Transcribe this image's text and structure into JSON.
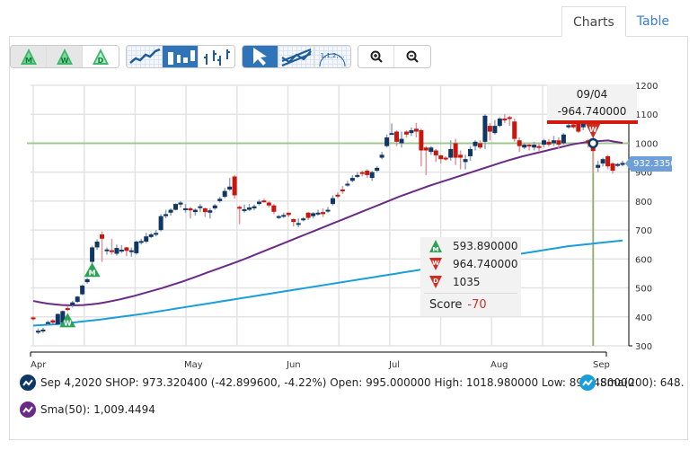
{
  "tabs": [
    {
      "label": "Charts",
      "active": true
    },
    {
      "label": "Table",
      "active": false
    }
  ],
  "toolbar": {
    "period_buttons": [
      {
        "label": "M",
        "icon": "monthly-triangle-icon"
      },
      {
        "label": "W",
        "icon": "weekly-triangle-icon"
      },
      {
        "label": "D",
        "icon": "daily-triangle-icon"
      }
    ],
    "chart_type_buttons": [
      {
        "icon": "line-chart-icon",
        "selected": false
      },
      {
        "icon": "candlestick-chart-icon",
        "selected": true
      },
      {
        "icon": "ohlc-chart-icon",
        "selected": false
      }
    ],
    "tool_buttons": [
      {
        "icon": "pointer-arrow-icon",
        "selected": true
      },
      {
        "icon": "trendline-channel-icon",
        "selected": false
      },
      {
        "icon": "fibonacci-icon",
        "label": "1,1,2,...",
        "selected": false
      }
    ],
    "zoom_buttons": [
      {
        "icon": "zoom-in-icon"
      },
      {
        "icon": "zoom-out-icon"
      }
    ]
  },
  "crosshair": {
    "date": "09/04",
    "value": "-964.740000"
  },
  "last_price_tag": "932.3350",
  "signal_tooltip": {
    "monthly": "593.890000",
    "weekly": "964.740000",
    "daily": "1035",
    "score_label": "Score",
    "score_value": "-70"
  },
  "legend": {
    "main": "Sep 4,2020 SHOP: 973.320400 (-42.899600, -4.22%) Open: 995.000000 High: 1018.980000 Low: 896.480000",
    "sma200": "Sma(200): 648.",
    "sma50": "Sma(50): 1,009.4494"
  },
  "colors": {
    "up": "#0f3766",
    "down": "#c8170c",
    "up_wick": "#8fa3bd",
    "down_wick": "#e0939a",
    "sma50": "#6b2a87",
    "sma200": "#1a9edb",
    "crosshair": "#8fc07a",
    "tab_link": "#3a7bd5"
  },
  "chart_data": {
    "type": "candlestick",
    "symbol": "SHOP",
    "xlabel": "",
    "ylabel": "",
    "ylim": [
      300,
      1200
    ],
    "yticks": [
      300,
      400,
      500,
      600,
      700,
      800,
      900,
      1000,
      1100,
      1200
    ],
    "xticks": [
      "Apr",
      "May",
      "Jun",
      "Jul",
      "Aug",
      "Sep"
    ],
    "grid": true,
    "candles": [
      [
        398,
        392,
        402,
        388
      ],
      [
        350,
        352,
        360,
        340
      ],
      [
        352,
        356,
        362,
        345
      ],
      [
        378,
        382,
        388,
        372
      ],
      [
        388,
        380,
        392,
        376
      ],
      [
        374,
        410,
        412,
        370
      ],
      [
        380,
        420,
        422,
        378
      ],
      [
        430,
        425,
        438,
        420
      ],
      [
        440,
        450,
        455,
        432
      ],
      [
        452,
        470,
        472,
        448
      ],
      [
        478,
        508,
        512,
        475
      ],
      [
        520,
        530,
        535,
        515
      ],
      [
        590,
        640,
        645,
        585
      ],
      [
        640,
        660,
        668,
        632
      ],
      [
        685,
        670,
        695,
        590
      ],
      [
        628,
        633,
        640,
        615
      ],
      [
        630,
        625,
        670,
        615
      ],
      [
        618,
        638,
        650,
        612
      ],
      [
        630,
        632,
        648,
        620
      ],
      [
        640,
        628,
        642,
        610
      ],
      [
        628,
        630,
        640,
        608
      ],
      [
        620,
        660,
        664,
        615
      ],
      [
        658,
        662,
        670,
        650
      ],
      [
        660,
        678,
        690,
        655
      ],
      [
        676,
        685,
        690,
        672
      ],
      [
        686,
        690,
        700,
        678
      ],
      [
        700,
        748,
        755,
        695
      ],
      [
        748,
        755,
        770,
        740
      ],
      [
        760,
        770,
        775,
        750
      ],
      [
        770,
        790,
        792,
        768
      ],
      [
        788,
        795,
        800,
        778
      ],
      [
        770,
        775,
        790,
        760
      ],
      [
        775,
        768,
        780,
        740
      ],
      [
        762,
        770,
        775,
        750
      ],
      [
        778,
        782,
        790,
        762
      ],
      [
        775,
        762,
        778,
        745
      ],
      [
        760,
        768,
        775,
        740
      ],
      [
        775,
        785,
        790,
        770
      ],
      [
        800,
        808,
        815,
        795
      ],
      [
        815,
        835,
        845,
        810
      ],
      [
        840,
        850,
        880,
        835
      ],
      [
        885,
        820,
        890,
        808
      ],
      [
        780,
        775,
        785,
        720
      ],
      [
        768,
        772,
        788,
        760
      ],
      [
        770,
        778,
        790,
        765
      ],
      [
        775,
        782,
        788,
        768
      ],
      [
        790,
        798,
        805,
        785
      ],
      [
        802,
        798,
        808,
        795
      ],
      [
        795,
        785,
        800,
        778
      ],
      [
        785,
        763,
        790,
        755
      ],
      [
        742,
        748,
        752,
        738
      ],
      [
        748,
        752,
        760,
        742
      ],
      [
        760,
        752,
        760,
        745
      ],
      [
        738,
        728,
        740,
        712
      ],
      [
        718,
        724,
        740,
        710
      ],
      [
        738,
        740,
        745,
        730
      ],
      [
        760,
        742,
        762,
        735
      ],
      [
        748,
        758,
        762,
        740
      ],
      [
        755,
        760,
        770,
        750
      ],
      [
        762,
        755,
        775,
        745
      ],
      [
        765,
        770,
        780,
        760
      ],
      [
        790,
        810,
        820,
        785
      ],
      [
        822,
        818,
        830,
        810
      ],
      [
        840,
        838,
        852,
        825
      ],
      [
        855,
        860,
        870,
        850
      ],
      [
        870,
        880,
        890,
        865
      ],
      [
        888,
        890,
        900,
        880
      ],
      [
        900,
        895,
        905,
        885
      ],
      [
        905,
        890,
        910,
        880
      ],
      [
        880,
        900,
        905,
        870
      ],
      [
        905,
        915,
        920,
        900
      ],
      [
        950,
        960,
        970,
        945
      ],
      [
        990,
        1020,
        1030,
        985
      ],
      [
        1030,
        1035,
        1068,
        1030
      ],
      [
        1040,
        1005,
        1045,
        990
      ],
      [
        1000,
        1015,
        1040,
        985
      ],
      [
        1040,
        1030,
        1045,
        1020
      ],
      [
        1035,
        1045,
        1055,
        1025
      ],
      [
        1050,
        1040,
        1070,
        1020
      ],
      [
        1045,
        975,
        1050,
        920
      ],
      [
        985,
        975,
        990,
        890
      ],
      [
        970,
        985,
        990,
        960
      ],
      [
        975,
        958,
        980,
        935
      ],
      [
        958,
        945,
        960,
        930
      ],
      [
        950,
        948,
        955,
        940
      ],
      [
        950,
        980,
        1010,
        940
      ],
      [
        1000,
        950,
        1015,
        925
      ],
      [
        960,
        950,
        975,
        910
      ],
      [
        935,
        945,
        960,
        910
      ],
      [
        955,
        980,
        990,
        940
      ],
      [
        990,
        1005,
        1010,
        975
      ],
      [
        1000,
        985,
        1010,
        980
      ],
      [
        1005,
        1095,
        1100,
        980
      ],
      [
        1060,
        1040,
        1070,
        1010
      ],
      [
        1035,
        1060,
        1080,
        1030
      ],
      [
        1060,
        1085,
        1090,
        1055
      ],
      [
        1085,
        1080,
        1100,
        1070
      ],
      [
        1090,
        1085,
        1095,
        1060
      ],
      [
        1075,
        1015,
        1085,
        1005
      ],
      [
        1010,
        990,
        1020,
        970
      ],
      [
        985,
        995,
        1000,
        980
      ],
      [
        995,
        990,
        1000,
        975
      ],
      [
        985,
        995,
        1005,
        975
      ],
      [
        990,
        985,
        1000,
        970
      ],
      [
        995,
        1010,
        1015,
        985
      ],
      [
        1005,
        995,
        1015,
        988
      ],
      [
        1000,
        1010,
        1025,
        990
      ],
      [
        1010,
        995,
        1020,
        980
      ],
      [
        1000,
        1030,
        1035,
        995
      ],
      [
        1055,
        1062,
        1075,
        1050
      ],
      [
        1065,
        1055,
        1070,
        1050
      ],
      [
        1070,
        1040,
        1075,
        1035
      ],
      [
        1055,
        1070,
        1080,
        1045
      ],
      [
        1010,
        1000,
        1015,
        985
      ],
      [
        995,
        973,
        1019,
        896
      ],
      [
        915,
        925,
        940,
        900
      ],
      [
        930,
        945,
        950,
        920
      ],
      [
        955,
        920,
        960,
        910
      ],
      [
        930,
        905,
        935,
        895
      ],
      [
        925,
        928,
        932,
        918
      ],
      [
        925,
        932,
        940,
        920
      ]
    ],
    "sma50": [
      455,
      450,
      446,
      443,
      441,
      440,
      440,
      441,
      443,
      446,
      450,
      455,
      460,
      466,
      472,
      479,
      486,
      493,
      500,
      508,
      516,
      524,
      533,
      542,
      551,
      560,
      569,
      578,
      587,
      596,
      606,
      616,
      626,
      636,
      646,
      656,
      666,
      676,
      686,
      696,
      706,
      716,
      726,
      736,
      746,
      756,
      766,
      776,
      786,
      796,
      806,
      816,
      825,
      834,
      843,
      852,
      860,
      868,
      876,
      884,
      892,
      900,
      908,
      916,
      924,
      932,
      940,
      947,
      954,
      960,
      966,
      972,
      978,
      984,
      990,
      996,
      1000,
      1004,
      1006,
      1008,
      1009.45,
      1005,
      1001
    ],
    "sma200": [
      370,
      372,
      374,
      378,
      382,
      386,
      390,
      395,
      400,
      405,
      410,
      416,
      422,
      428,
      434,
      440,
      446,
      452,
      458,
      464,
      470,
      476,
      482,
      488,
      494,
      500,
      506,
      512,
      518,
      524,
      530,
      536,
      542,
      548,
      554,
      560,
      566,
      572,
      578,
      584,
      590,
      596,
      602,
      608,
      614,
      620,
      626,
      632,
      638,
      644,
      648,
      652,
      656,
      660,
      664
    ],
    "crosshair_index": 114,
    "crosshair_price": 1000,
    "signals": [
      {
        "type": "M",
        "direction": "up",
        "index": 12,
        "price": 593.89
      },
      {
        "type": "W",
        "direction": "up",
        "index": 7,
        "price": 420
      },
      {
        "type": "W",
        "direction": "down",
        "index": 114,
        "price": 964.74
      },
      {
        "type": "D",
        "direction": "down",
        "index": 114,
        "price": 1035
      }
    ]
  }
}
